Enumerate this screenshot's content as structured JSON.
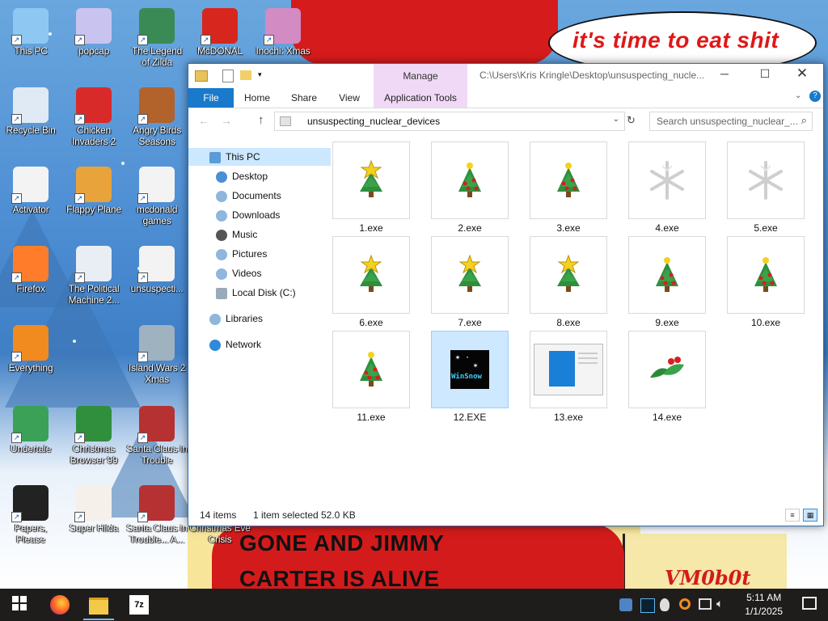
{
  "wallpaper": {
    "speech_text": "it's time to eat shit",
    "banner_line1": "GONE AND JIMMY",
    "banner_line2": "CARTER IS ALIVE",
    "signature": "VM0b0t"
  },
  "desktop_icons": [
    {
      "label_1": "This PC",
      "label_2": "",
      "icon": "computer-icon",
      "color": "#8ec7f2"
    },
    {
      "label_1": "popcap",
      "label_2": "",
      "icon": "folder-icon",
      "color": "#c9c4ef"
    },
    {
      "label_1": "The Legend",
      "label_2": "of Zilda",
      "icon": "game-icon",
      "color": "#3a8a55"
    },
    {
      "label_1": "McDONAL",
      "label_2": "",
      "icon": "game-icon",
      "color": "#d7261e"
    },
    {
      "label_1": "Inochi: Xmas",
      "label_2": "",
      "icon": "game-icon",
      "color": "#d38bc4"
    },
    {
      "label_1": "Recycle Bin",
      "label_2": "",
      "icon": "recycle-bin-icon",
      "color": "#dfeaf4"
    },
    {
      "label_1": "Chicken",
      "label_2": "Invaders 2",
      "icon": "game-icon",
      "color": "#d92a2a"
    },
    {
      "label_1": "Angry Birds",
      "label_2": "Seasons",
      "icon": "game-icon",
      "color": "#b2622b"
    },
    {
      "label_1": "Activator",
      "label_2": "",
      "icon": "folder-icon",
      "color": "#f3f3f3"
    },
    {
      "label_1": "Flappy Plane",
      "label_2": "",
      "icon": "game-icon",
      "color": "#e8a33a"
    },
    {
      "label_1": "mcdonald",
      "label_2": "games",
      "icon": "folder-icon",
      "color": "#f3f3f3"
    },
    {
      "label_1": "Firefox",
      "label_2": "",
      "icon": "firefox-icon",
      "color": "#ff7d2a"
    },
    {
      "label_1": "The Political",
      "label_2": "Machine 2...",
      "icon": "game-icon",
      "color": "#e9eef5"
    },
    {
      "label_1": "unsuspecti...",
      "label_2": "",
      "icon": "folder-icon",
      "color": "#f3f3f3"
    },
    {
      "label_1": "Everything",
      "label_2": "",
      "icon": "search-icon",
      "color": "#f18a1f"
    },
    {
      "label_1": "Island Wars 2",
      "label_2": "Xmas",
      "icon": "game-icon",
      "color": "#9fb2bf"
    },
    {
      "label_1": "Undertale",
      "label_2": "",
      "icon": "game-icon",
      "color": "#3aa157"
    },
    {
      "label_1": "Christmas",
      "label_2": "Browser 99",
      "icon": "tree-icon",
      "color": "#2f8f3d"
    },
    {
      "label_1": "Santa Claus in",
      "label_2": "Trouble",
      "icon": "game-icon",
      "color": "#b63131"
    },
    {
      "label_1": "Papers, Please",
      "label_2": "",
      "icon": "game-icon",
      "color": "#222222"
    },
    {
      "label_1": "Super Hilda",
      "label_2": "",
      "icon": "game-icon",
      "color": "#f5f0ea"
    },
    {
      "label_1": "Santa Claus in",
      "label_2": "Trouble... A...",
      "icon": "game-icon",
      "color": "#b63131"
    },
    {
      "label_1": "Christmas Eve",
      "label_2": "Crisis",
      "icon": "snowman-icon",
      "color": "#ffffff"
    }
  ],
  "explorer": {
    "path_title": "C:\\Users\\Kris Kringle\\Desktop\\unsuspecting_nucle...",
    "context_tab": "Manage",
    "tabs": {
      "file": "File",
      "home": "Home",
      "share": "Share",
      "view": "View",
      "app_tools": "Application Tools"
    },
    "address": "unsuspecting_nuclear_devices",
    "search_placeholder": "Search unsuspecting_nuclear_...",
    "nav": {
      "this_pc": "This PC",
      "desktop": "Desktop",
      "documents": "Documents",
      "downloads": "Downloads",
      "music": "Music",
      "pictures": "Pictures",
      "videos": "Videos",
      "local_disk": "Local Disk (C:)",
      "libraries": "Libraries",
      "network": "Network"
    },
    "files": [
      {
        "name": "1.exe",
        "icon": "tree-star-icon"
      },
      {
        "name": "2.exe",
        "icon": "tree-ornaments-icon"
      },
      {
        "name": "3.exe",
        "icon": "tree-ornaments-icon"
      },
      {
        "name": "4.exe",
        "icon": "snowflake-icon"
      },
      {
        "name": "5.exe",
        "icon": "snowflake-icon"
      },
      {
        "name": "6.exe",
        "icon": "tree-star-icon"
      },
      {
        "name": "7.exe",
        "icon": "tree-star-icon"
      },
      {
        "name": "8.exe",
        "icon": "tree-star-icon"
      },
      {
        "name": "9.exe",
        "icon": "tree-ornaments-icon"
      },
      {
        "name": "10.exe",
        "icon": "tree-ornaments-icon"
      },
      {
        "name": "11.exe",
        "icon": "tree-ornaments-icon"
      },
      {
        "name": "12.EXE",
        "icon": "winsnow-icon"
      },
      {
        "name": "13.exe",
        "icon": "window-app-icon"
      },
      {
        "name": "14.exe",
        "icon": "holly-icon"
      }
    ],
    "winsnow_text": "WinSnow",
    "status": {
      "count": "14 items",
      "selected": "1 item selected",
      "size": "52.0 KB"
    }
  },
  "taskbar": {
    "time": "5:11 AM",
    "date": "1/1/2025"
  }
}
